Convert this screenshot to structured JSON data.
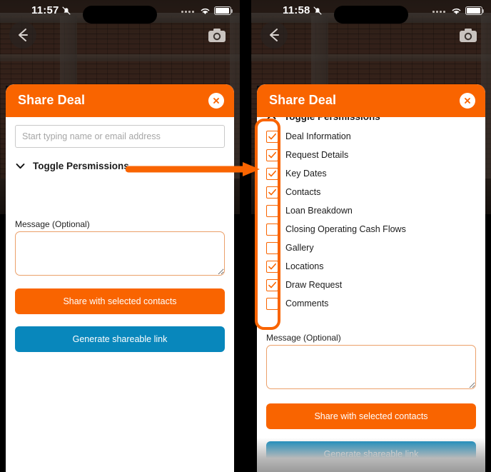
{
  "accent": {
    "orange": "#F96400",
    "blue": "#0887BC",
    "white": "#FFFFFF"
  },
  "panels": [
    {
      "id": "before",
      "status": {
        "time": "11:57",
        "mute_icon": "bell-slash-icon",
        "wifi_icon": "wifi-icon",
        "battery_icon": "battery-icon",
        "signal_icon": "signal-dots-icon"
      },
      "nav": {
        "back_icon": "back-arrow-icon",
        "camera_icon": "camera-icon"
      },
      "sheet": {
        "title": "Share Deal",
        "close_icon": "close-icon",
        "contact_input": {
          "value": "",
          "placeholder": "Start typing name or email address"
        },
        "toggle": {
          "label": "Toggle Persmissions",
          "chevron_icon": "chevron-down-icon",
          "expanded": false
        },
        "message": {
          "label": "Message (Optional)",
          "value": "",
          "placeholder": ""
        },
        "share_button": "Share with selected contacts",
        "link_button": "Generate shareable link"
      }
    },
    {
      "id": "after",
      "status": {
        "time": "11:58",
        "mute_icon": "bell-slash-icon",
        "wifi_icon": "wifi-icon",
        "battery_icon": "battery-icon",
        "signal_icon": "signal-dots-icon"
      },
      "nav": {
        "back_icon": "back-arrow-icon",
        "camera_icon": "camera-icon"
      },
      "sheet": {
        "title": "Share Deal",
        "close_icon": "close-icon",
        "toggle": {
          "label": "Toggle Persmissions",
          "chevron_icon": "chevron-up-icon",
          "expanded": true
        },
        "permissions": [
          {
            "label": "Deal Information",
            "checked": true
          },
          {
            "label": "Request Details",
            "checked": true
          },
          {
            "label": "Key Dates",
            "checked": true
          },
          {
            "label": "Contacts",
            "checked": true
          },
          {
            "label": "Loan Breakdown",
            "checked": false
          },
          {
            "label": "Closing Operating Cash Flows",
            "checked": false
          },
          {
            "label": "Gallery",
            "checked": false
          },
          {
            "label": "Locations",
            "checked": true
          },
          {
            "label": "Draw Request",
            "checked": true
          },
          {
            "label": "Comments",
            "checked": false
          }
        ],
        "message": {
          "label": "Message (Optional)",
          "value": "",
          "placeholder": ""
        },
        "share_button": "Share with selected contacts",
        "link_button": "Generate shareable link"
      }
    }
  ],
  "annotations": {
    "arrow": {
      "name": "callout-arrow",
      "color": "#F96400"
    },
    "highlight": {
      "name": "permissions-highlight-box",
      "color": "#F96400"
    }
  }
}
